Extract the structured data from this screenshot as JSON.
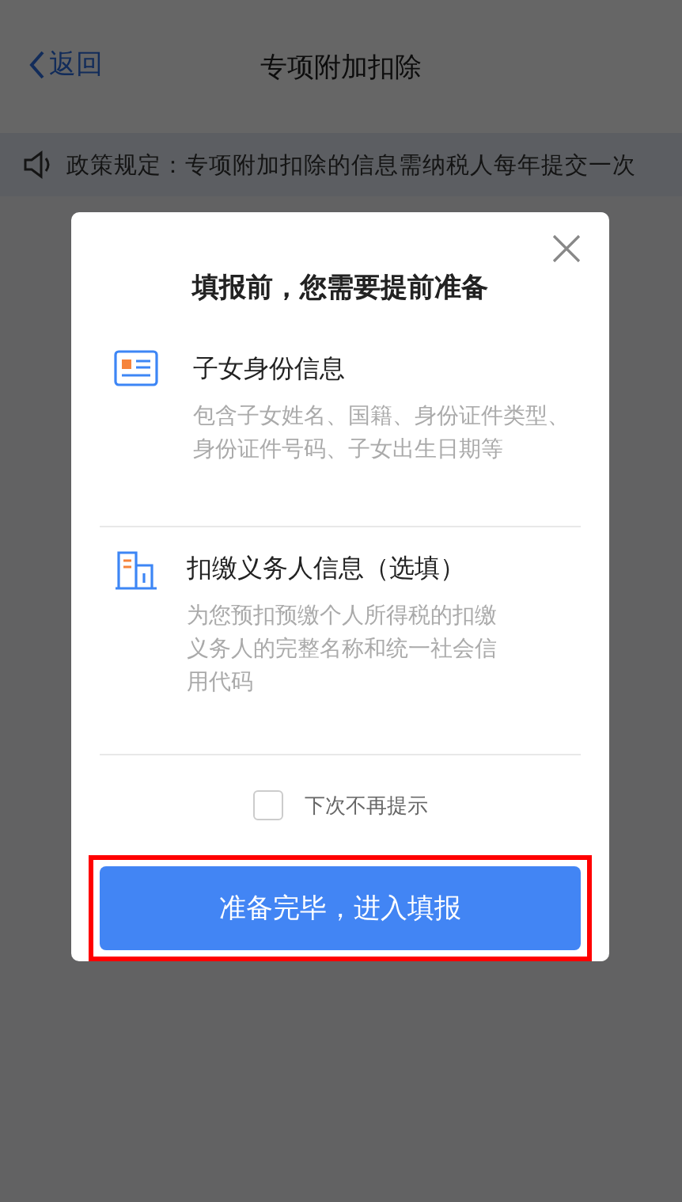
{
  "nav": {
    "back": "返回",
    "title": "专项附加扣除"
  },
  "notice": "政策规定：专项附加扣除的信息需纳税人每年提交一次",
  "dialog": {
    "title": "填报前，您需要提前准备",
    "items": [
      {
        "kind": "id-card",
        "title": "子女身份信息",
        "description": "包含子女姓名、国籍、身份证件类型、身份证件号码、子女出生日期等"
      },
      {
        "kind": "building",
        "title": "扣缴义务人信息（选填）",
        "description": "为您预扣预缴个人所得税的扣缴义务人的完整名称和统一社会信用代码"
      }
    ],
    "dont_show_again": {
      "label": "下次不再提示",
      "checked": false
    },
    "confirm_button": {
      "label": "准备完毕，进入填报",
      "highlighted": true
    }
  }
}
